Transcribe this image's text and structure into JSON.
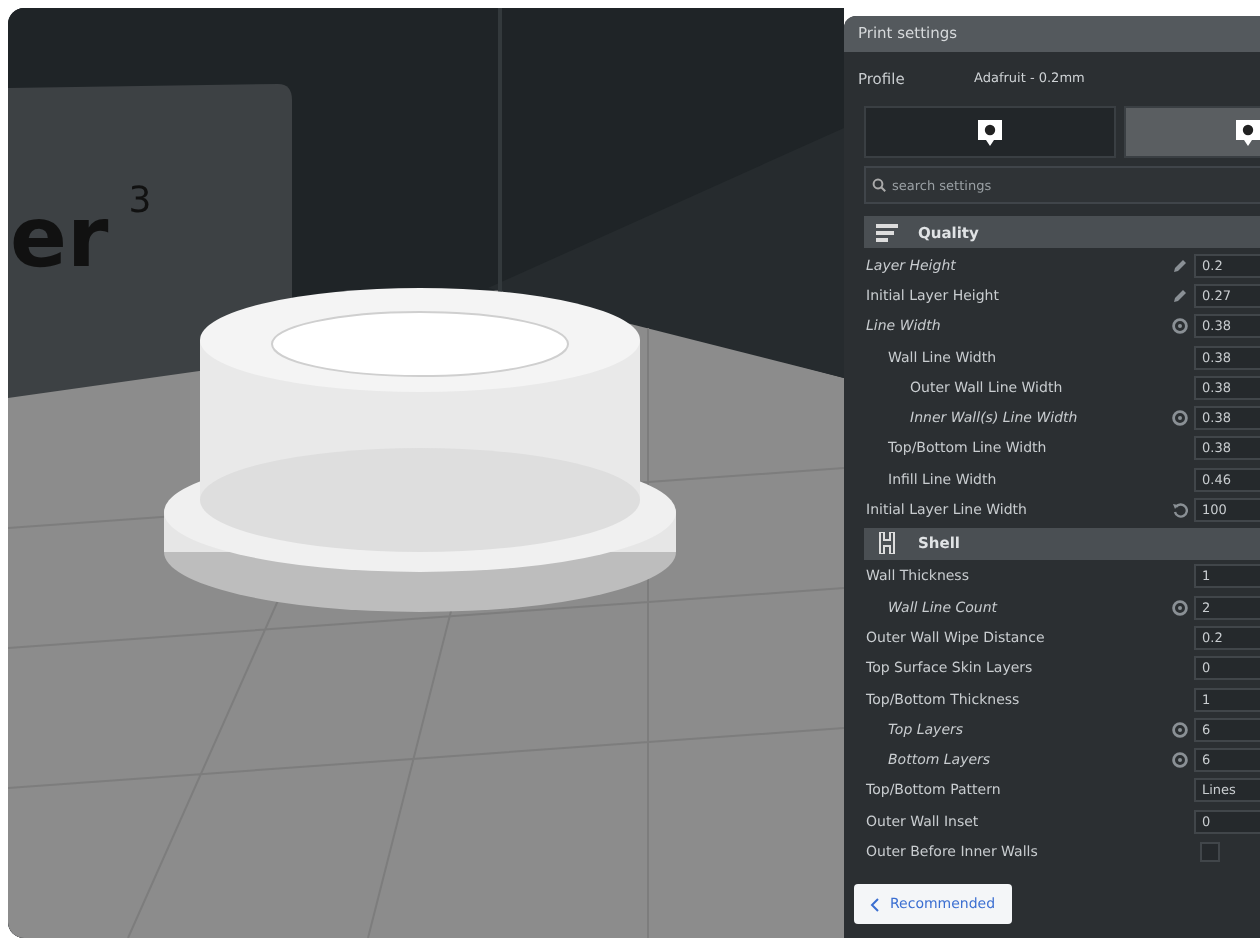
{
  "viewport": {
    "printer_label": "er$^{3}$"
  },
  "panel": {
    "title": "Print settings",
    "profile_label": "Profile",
    "profile_value": "Adafruit - 0.2mm",
    "extruder_tabs": [
      {
        "selected": true
      },
      {
        "selected": false
      }
    ],
    "search": {
      "placeholder": "search settings"
    },
    "categories": [
      {
        "name": "Quality",
        "kind": "quality",
        "rows": [
          {
            "label": "Layer Height",
            "kind": "value",
            "value": "0.2",
            "modified": true,
            "linked": false,
            "resettable": false,
            "emphasized": true
          },
          {
            "label": "Initial Layer Height",
            "kind": "value",
            "value": "0.27",
            "modified": true,
            "linked": false,
            "resettable": false,
            "emphasized": false
          },
          {
            "label": "Line Width",
            "kind": "value",
            "value": "0.38",
            "modified": false,
            "linked": true,
            "resettable": false,
            "emphasized": true,
            "children": [
              {
                "label": "Wall Line Width",
                "kind": "value",
                "value": "0.38",
                "modified": false,
                "linked": false,
                "resettable": false,
                "emphasized": false,
                "children": [
                  {
                    "label": "Outer Wall Line Width",
                    "kind": "value",
                    "value": "0.38",
                    "modified": false,
                    "linked": false,
                    "resettable": false,
                    "emphasized": false
                  },
                  {
                    "label": "Inner Wall(s) Line Width",
                    "kind": "value",
                    "value": "0.38",
                    "modified": false,
                    "linked": true,
                    "resettable": false,
                    "emphasized": true
                  }
                ]
              },
              {
                "label": "Top/Bottom Line Width",
                "kind": "value",
                "value": "0.38",
                "modified": false,
                "linked": false,
                "resettable": false,
                "emphasized": false
              },
              {
                "label": "Infill Line Width",
                "kind": "value",
                "value": "0.46",
                "modified": false,
                "linked": false,
                "resettable": false,
                "emphasized": false
              }
            ]
          },
          {
            "label": "Initial Layer Line Width",
            "kind": "value",
            "value": "100",
            "modified": false,
            "linked": false,
            "resettable": true,
            "emphasized": false
          }
        ]
      },
      {
        "name": "Shell",
        "kind": "shell",
        "rows": [
          {
            "label": "Wall Thickness",
            "kind": "value",
            "value": "1",
            "modified": false,
            "linked": false,
            "resettable": false,
            "emphasized": false,
            "children": [
              {
                "label": "Wall Line Count",
                "kind": "value",
                "value": "2",
                "modified": false,
                "linked": true,
                "resettable": false,
                "emphasized": true
              }
            ]
          },
          {
            "label": "Outer Wall Wipe Distance",
            "kind": "value",
            "value": "0.2",
            "modified": false,
            "linked": false,
            "resettable": false,
            "emphasized": false
          },
          {
            "label": "Top Surface Skin Layers",
            "kind": "value",
            "value": "0",
            "modified": false,
            "linked": false,
            "resettable": false,
            "emphasized": false
          },
          {
            "label": "Top/Bottom Thickness",
            "kind": "value",
            "value": "1",
            "modified": false,
            "linked": false,
            "resettable": false,
            "emphasized": false,
            "children": [
              {
                "label": "Top Layers",
                "kind": "value",
                "value": "6",
                "modified": false,
                "linked": true,
                "resettable": false,
                "emphasized": true
              },
              {
                "label": "Bottom Layers",
                "kind": "value",
                "value": "6",
                "modified": false,
                "linked": true,
                "resettable": false,
                "emphasized": true
              }
            ]
          },
          {
            "label": "Top/Bottom Pattern",
            "kind": "value",
            "value": "Lines",
            "modified": false,
            "linked": false,
            "resettable": false,
            "emphasized": false
          },
          {
            "label": "Outer Wall Inset",
            "kind": "value",
            "value": "0",
            "modified": false,
            "linked": false,
            "resettable": false,
            "emphasized": false
          },
          {
            "label": "Outer Before Inner Walls",
            "kind": "checkbox",
            "checked": false,
            "modified": false,
            "linked": false,
            "resettable": false,
            "emphasized": false
          }
        ]
      }
    ],
    "recommended_button": "Recommended"
  }
}
